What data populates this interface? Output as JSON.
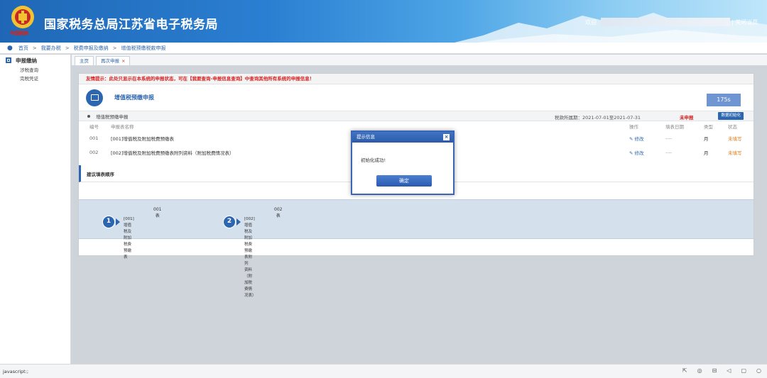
{
  "header": {
    "title": "国家税务总局江苏省电子税务局",
    "emblem_caption": "中国税务",
    "welcome": "欢迎",
    "close_page": "| 关闭当页"
  },
  "breadcrumb": [
    "首页",
    "我要办税",
    "税费申报及缴纳",
    "增值税预缴税款申报"
  ],
  "breadcrumb_sep": ">",
  "sidebar": {
    "group": "申报缴纳",
    "items": [
      "涉税查询",
      "完税凭证"
    ]
  },
  "tabs": [
    {
      "label": "主页"
    },
    {
      "label": "再次申报",
      "close": "×"
    }
  ],
  "main": {
    "tip": "友情提示：此处只显示在本系统的申报状态，可在【我要查询-申报信息查询】中查询其他所有系统的申报信息！",
    "form_title": "增值税预缴申报",
    "timer": "175s",
    "sub_title": "增值税预缴申报",
    "period": "税款所属期：2021-07-01至2021-07-31",
    "unfiled": "未申报",
    "init_button": "数据初始化",
    "columns": {
      "no": "编号",
      "name": "申报表名称",
      "op": "操作",
      "date": "填表日期",
      "type": "类型",
      "status": "状态"
    },
    "rows": [
      {
        "no": "001",
        "name": "[001]增值税及附加税费预缴表",
        "op": "修改",
        "date": "----",
        "type": "月",
        "status": "未填写"
      },
      {
        "no": "002",
        "name": "[002]增值税及附加税费预缴表附列资料（附加税费情况表）",
        "op": "修改",
        "date": "----",
        "type": "月",
        "status": "未填写"
      }
    ],
    "suggest_title": "建议填表顺序",
    "steps": [
      {
        "num": "1",
        "code": "001表",
        "desc_l1": "[001]增值税及附加税费预缴表",
        "desc_l2": ""
      },
      {
        "num": "2",
        "code": "002表",
        "desc_l1": "[002]增值税及附加税费预缴表附列",
        "desc_l2": "资料（附加税费情况表）"
      }
    ]
  },
  "modal": {
    "title": "提示信息",
    "close": "×",
    "message": "初始化成功!",
    "ok": "确定"
  },
  "statusbar": {
    "text": "javascript:;",
    "icons": [
      "share-icon",
      "circle-icon",
      "trash-icon",
      "audio-icon",
      "window-icon",
      "search-icon"
    ]
  },
  "colors": {
    "brand": "#2d66b0",
    "alert": "#d42020",
    "pending": "#e07b1a"
  }
}
